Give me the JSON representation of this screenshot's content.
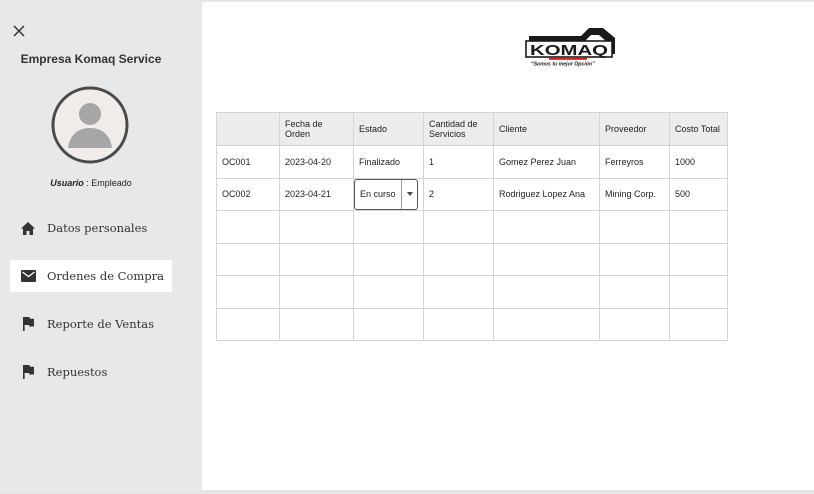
{
  "sidebar": {
    "company": "Empresa Komaq Service",
    "user_label": "Usuario",
    "user_sep": " : ",
    "user_role": "Empleado",
    "items": [
      {
        "label": "Datos personales",
        "icon": "home-icon",
        "active": false
      },
      {
        "label": "Ordenes de Compra",
        "icon": "mail-icon",
        "active": true
      },
      {
        "label": "Reporte de Ventas",
        "icon": "flag-icon",
        "active": false
      },
      {
        "label": "Repuestos",
        "icon": "flag-icon",
        "active": false
      }
    ]
  },
  "logo": {
    "brand": "KOMAQ",
    "tagline": "“Somos tu mejor Opción”",
    "accent": "#d01f1f"
  },
  "table": {
    "headers": [
      "",
      "Fecha de Orden",
      "Estado",
      "Cantidad de Servicios",
      "Cliente",
      "Proveedor",
      "Costo Total"
    ],
    "rows": [
      [
        "OC001",
        "2023-04-20",
        "Finalizado",
        "1",
        "Gomez Perez Juan",
        "Ferreyros",
        "1000"
      ],
      [
        "OC002",
        "2023-04-21",
        "En curso",
        "2",
        "Rodriguez Lopez Ana",
        "Mining Corp.",
        "500"
      ]
    ],
    "empty_rows": 4
  }
}
